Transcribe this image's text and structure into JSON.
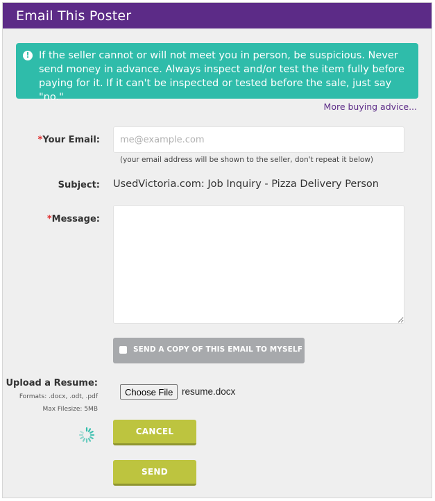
{
  "header": {
    "title": "Email This Poster",
    "color": "#5c2b87"
  },
  "alert": {
    "icon": "exclamation-circle-icon",
    "text": "If the seller cannot or will not meet you in person, be suspicious. Never send money in advance. Always inspect and/or test the item fully before paying for it. If it can't be inspected or tested before the sale, just say \"no.\"",
    "color": "#2fbcaa"
  },
  "advice_link": "More buying advice...",
  "form": {
    "required_mark": "*",
    "email": {
      "label": "Your Email:",
      "placeholder": "me@example.com",
      "value": "",
      "note": "(your email address will be shown to the seller, don't repeat it below)"
    },
    "subject": {
      "label": "Subject:",
      "value": "UsedVictoria.com: Job Inquiry - Pizza Delivery Person"
    },
    "message": {
      "label": "Message:",
      "value": ""
    },
    "copy_to_self": {
      "label": "SEND A COPY OF THIS EMAIL TO MYSELF",
      "checked": false
    },
    "upload": {
      "label": "Upload a Resume:",
      "formats": "Formats: .docx, .odt, .pdf",
      "max_size": "Max Filesize: 5MB",
      "button": "Choose File",
      "file_name": "resume.docx"
    },
    "cancel_label": "CANCEL",
    "send_label": "SEND",
    "button_color": "#bdc43f"
  }
}
